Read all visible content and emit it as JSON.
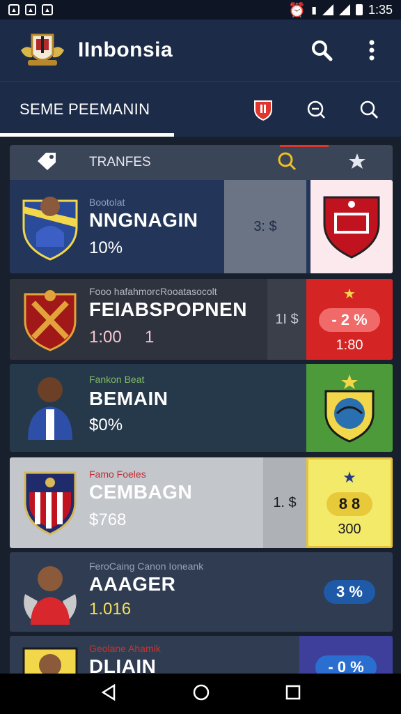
{
  "status": {
    "time": "1:35"
  },
  "app": {
    "title": "IInbonsia"
  },
  "tab": {
    "label": "SEME PEEMANIN"
  },
  "subheader": {
    "label": "TRANFES"
  },
  "cards": [
    {
      "meta": "Bootolat",
      "name": "NNGNAGIN",
      "stat": "10%",
      "mid": "3: $",
      "right_value": ""
    },
    {
      "meta": "Fooo hafahmorcRooatasocolt",
      "name": "FEIABSPOPNEN",
      "stat": "1:00     1",
      "mid": "1I $",
      "right_pill": "- 2 %",
      "right_value": "1:80"
    },
    {
      "meta": "Fankon Beat",
      "name": "BEMAIN",
      "stat": "$0%",
      "mid": "",
      "right_value": ""
    },
    {
      "meta": "Famo Foeles",
      "name": "CEMBAGN",
      "stat": "$768",
      "mid": "1. $",
      "right_pill": "8 8",
      "right_value": "300"
    },
    {
      "meta": "FeroCaing Canon Ioneank",
      "name": "AAAGER",
      "stat": "1.016",
      "mid": "",
      "right_pill": "3 %",
      "right_value": ""
    },
    {
      "meta": "Geolane Ahamik",
      "name": "DLIAIN",
      "stat": "",
      "mid": "",
      "right_pill": "- 0 %",
      "right_value": ""
    }
  ],
  "colors": {
    "accent_red": "#e0342c",
    "card_blue": "#23365a",
    "card_gold": "#f3d74a"
  }
}
